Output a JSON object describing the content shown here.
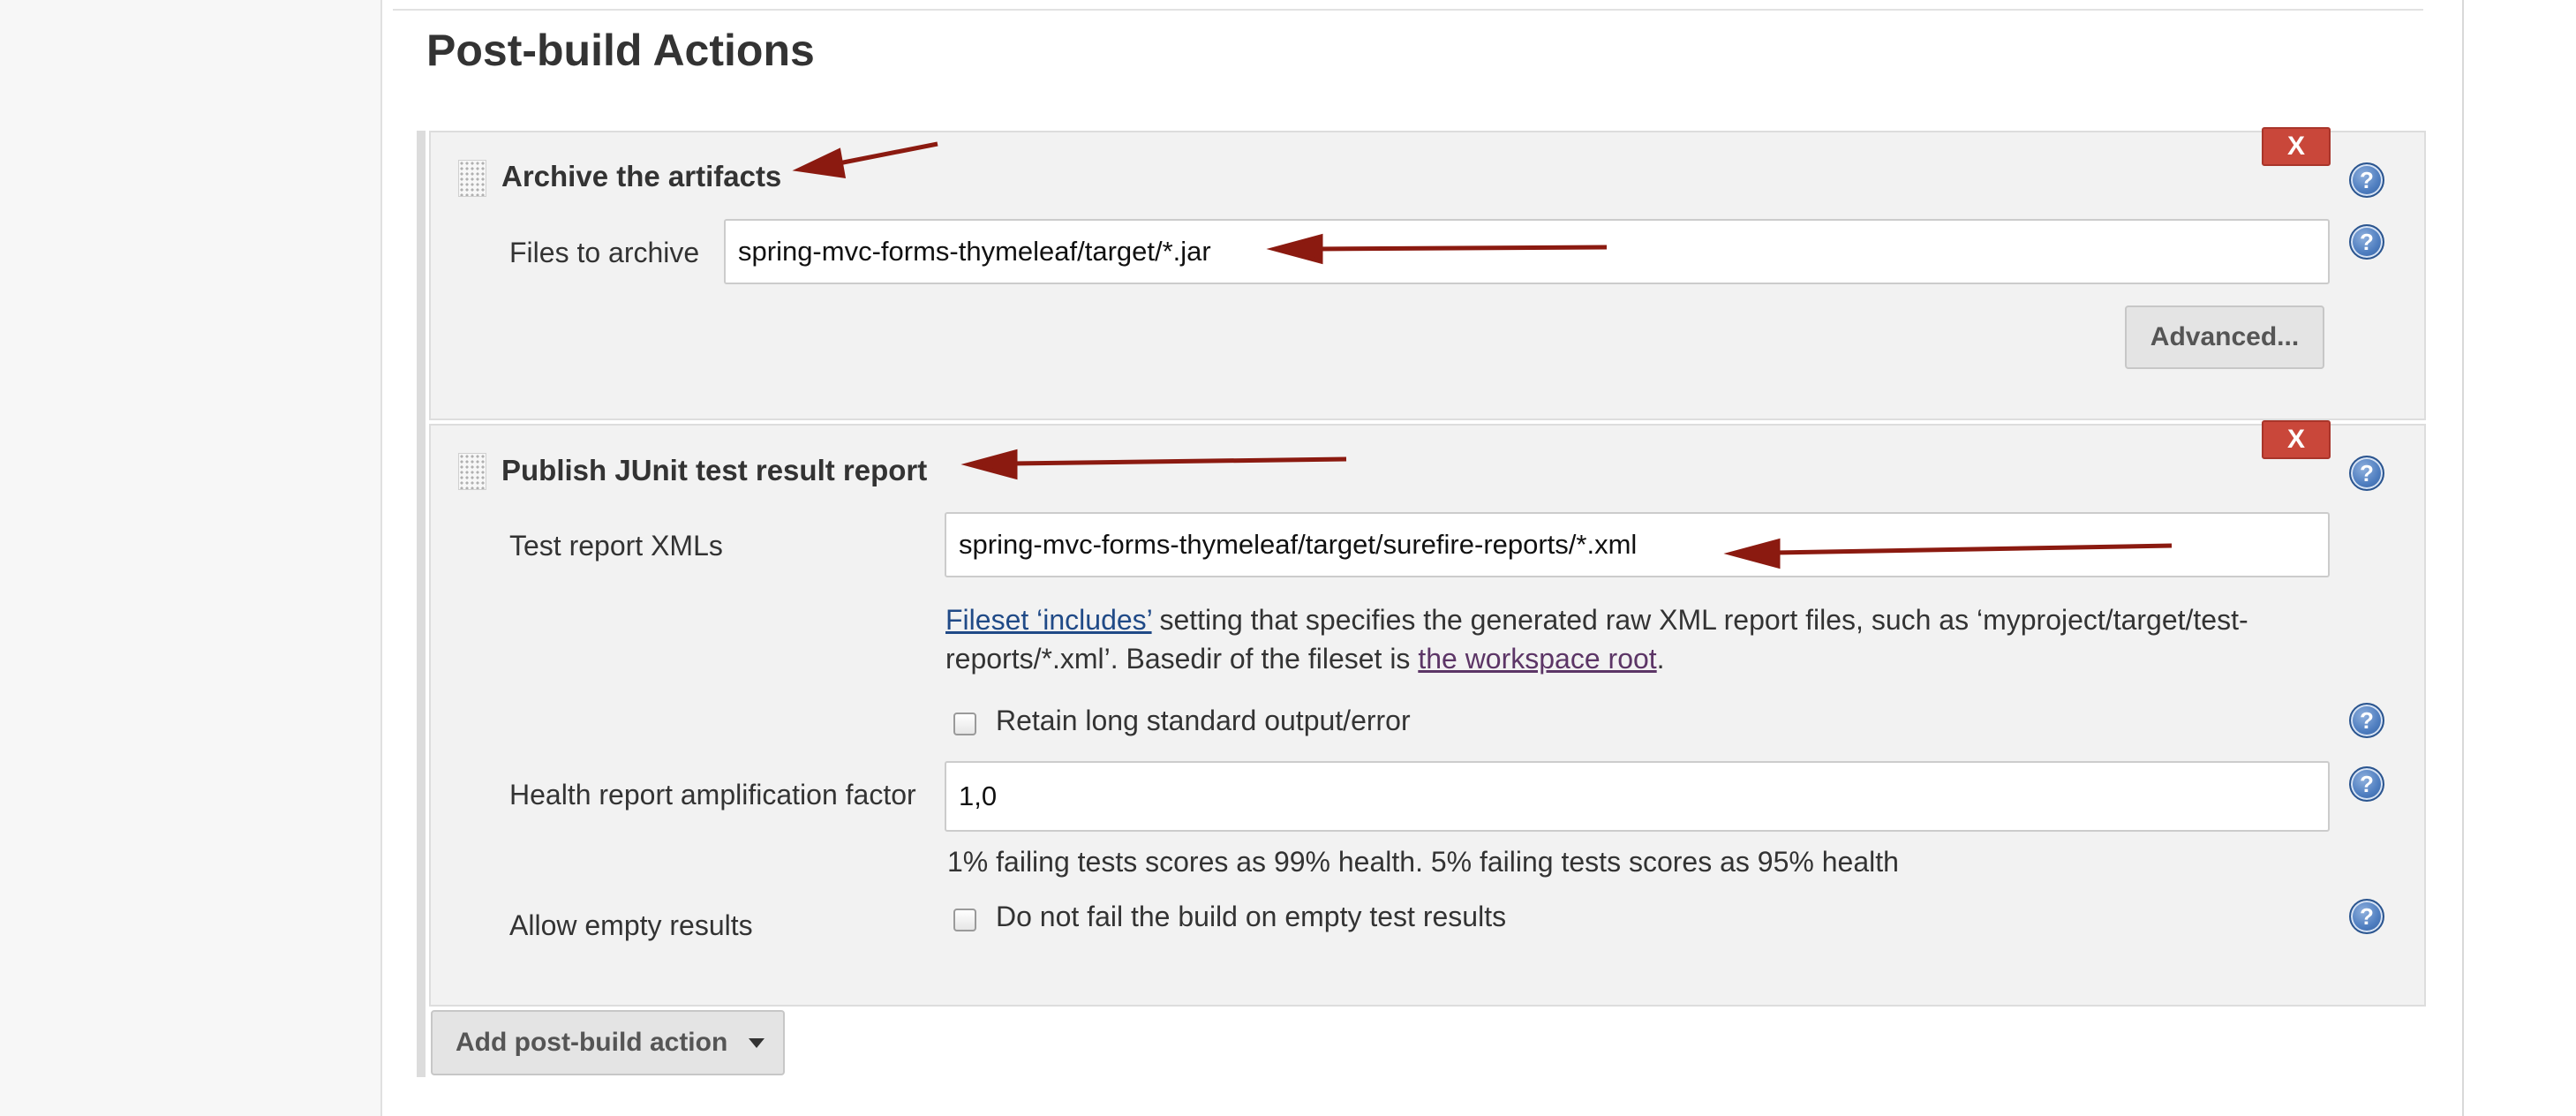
{
  "section": {
    "title": "Post-build Actions"
  },
  "archive": {
    "title": "Archive the artifacts",
    "delete_label": "X",
    "help_icon": "help-icon",
    "files_label": "Files to archive",
    "files_value": "spring-mvc-forms-thymeleaf/target/*.jar",
    "advanced_label": "Advanced..."
  },
  "junit": {
    "title": "Publish JUnit test result report",
    "delete_label": "X",
    "xml_label": "Test report XMLs",
    "xml_value": "spring-mvc-forms-thymeleaf/target/surefire-reports/*.xml",
    "desc": {
      "link1": "Fileset ‘includes’",
      "text1": " setting that specifies the generated raw XML report files, such as ‘myproject/target/test-reports/*.xml’. Basedir of the fileset is ",
      "link2": "the workspace root",
      "text2": "."
    },
    "retain_label": "Retain long standard output/error",
    "retain_checked": false,
    "health_label": "Health report amplification factor",
    "health_value": "1,0",
    "health_desc": "1% failing tests scores as 99% health. 5% failing tests scores as 95% health",
    "empty_label": "Allow empty results",
    "empty_checkbox_label": "Do not fail the build on empty test results",
    "empty_checked": false
  },
  "add_action": {
    "label": "Add post-build action",
    "icon": "caret-down-icon"
  },
  "colors": {
    "delete_red": "#c9473a",
    "annotation_arrow": "#8b1a10",
    "link_blue": "#204a87",
    "link_visited": "#5c3566"
  }
}
